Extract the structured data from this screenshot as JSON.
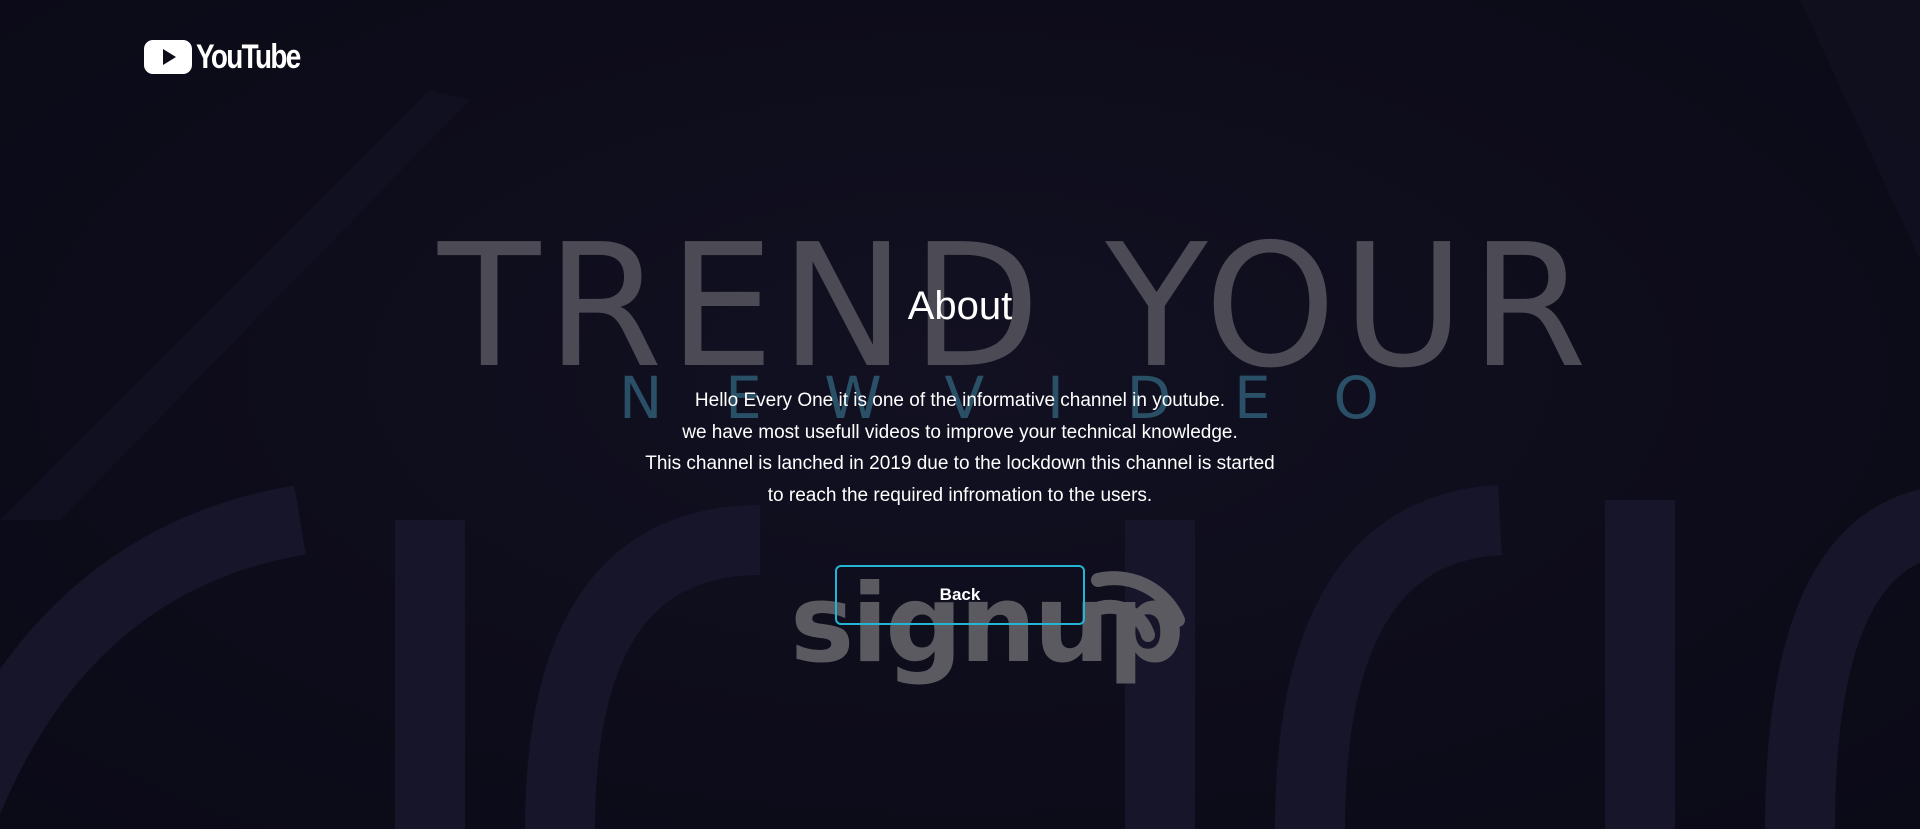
{
  "brand": {
    "logo_text": "YouTube",
    "icon": "youtube-play-icon"
  },
  "hero": {
    "title": "TREND YOUR",
    "subtitle_letters": [
      "N",
      "E",
      "W",
      "V",
      "I",
      "D",
      "E",
      "O"
    ],
    "signup_text": "signup",
    "signup_icon": "wifi-signal-icon"
  },
  "about": {
    "heading": "About",
    "lines": [
      "Hello Every One it is one of the informative channel in youtube.",
      "we have most usefull videos to improve your technical knowledge.",
      "This channel is lanched in 2019 due to the lockdown this channel is started",
      "to reach the required infromation to the users."
    ],
    "back_label": "Back"
  },
  "colors": {
    "background": "#0d0c1a",
    "accent": "#23b5d3",
    "title_gray": "#4c4b55",
    "subtitle_blue": "#2a5067",
    "text": "#ffffff"
  }
}
